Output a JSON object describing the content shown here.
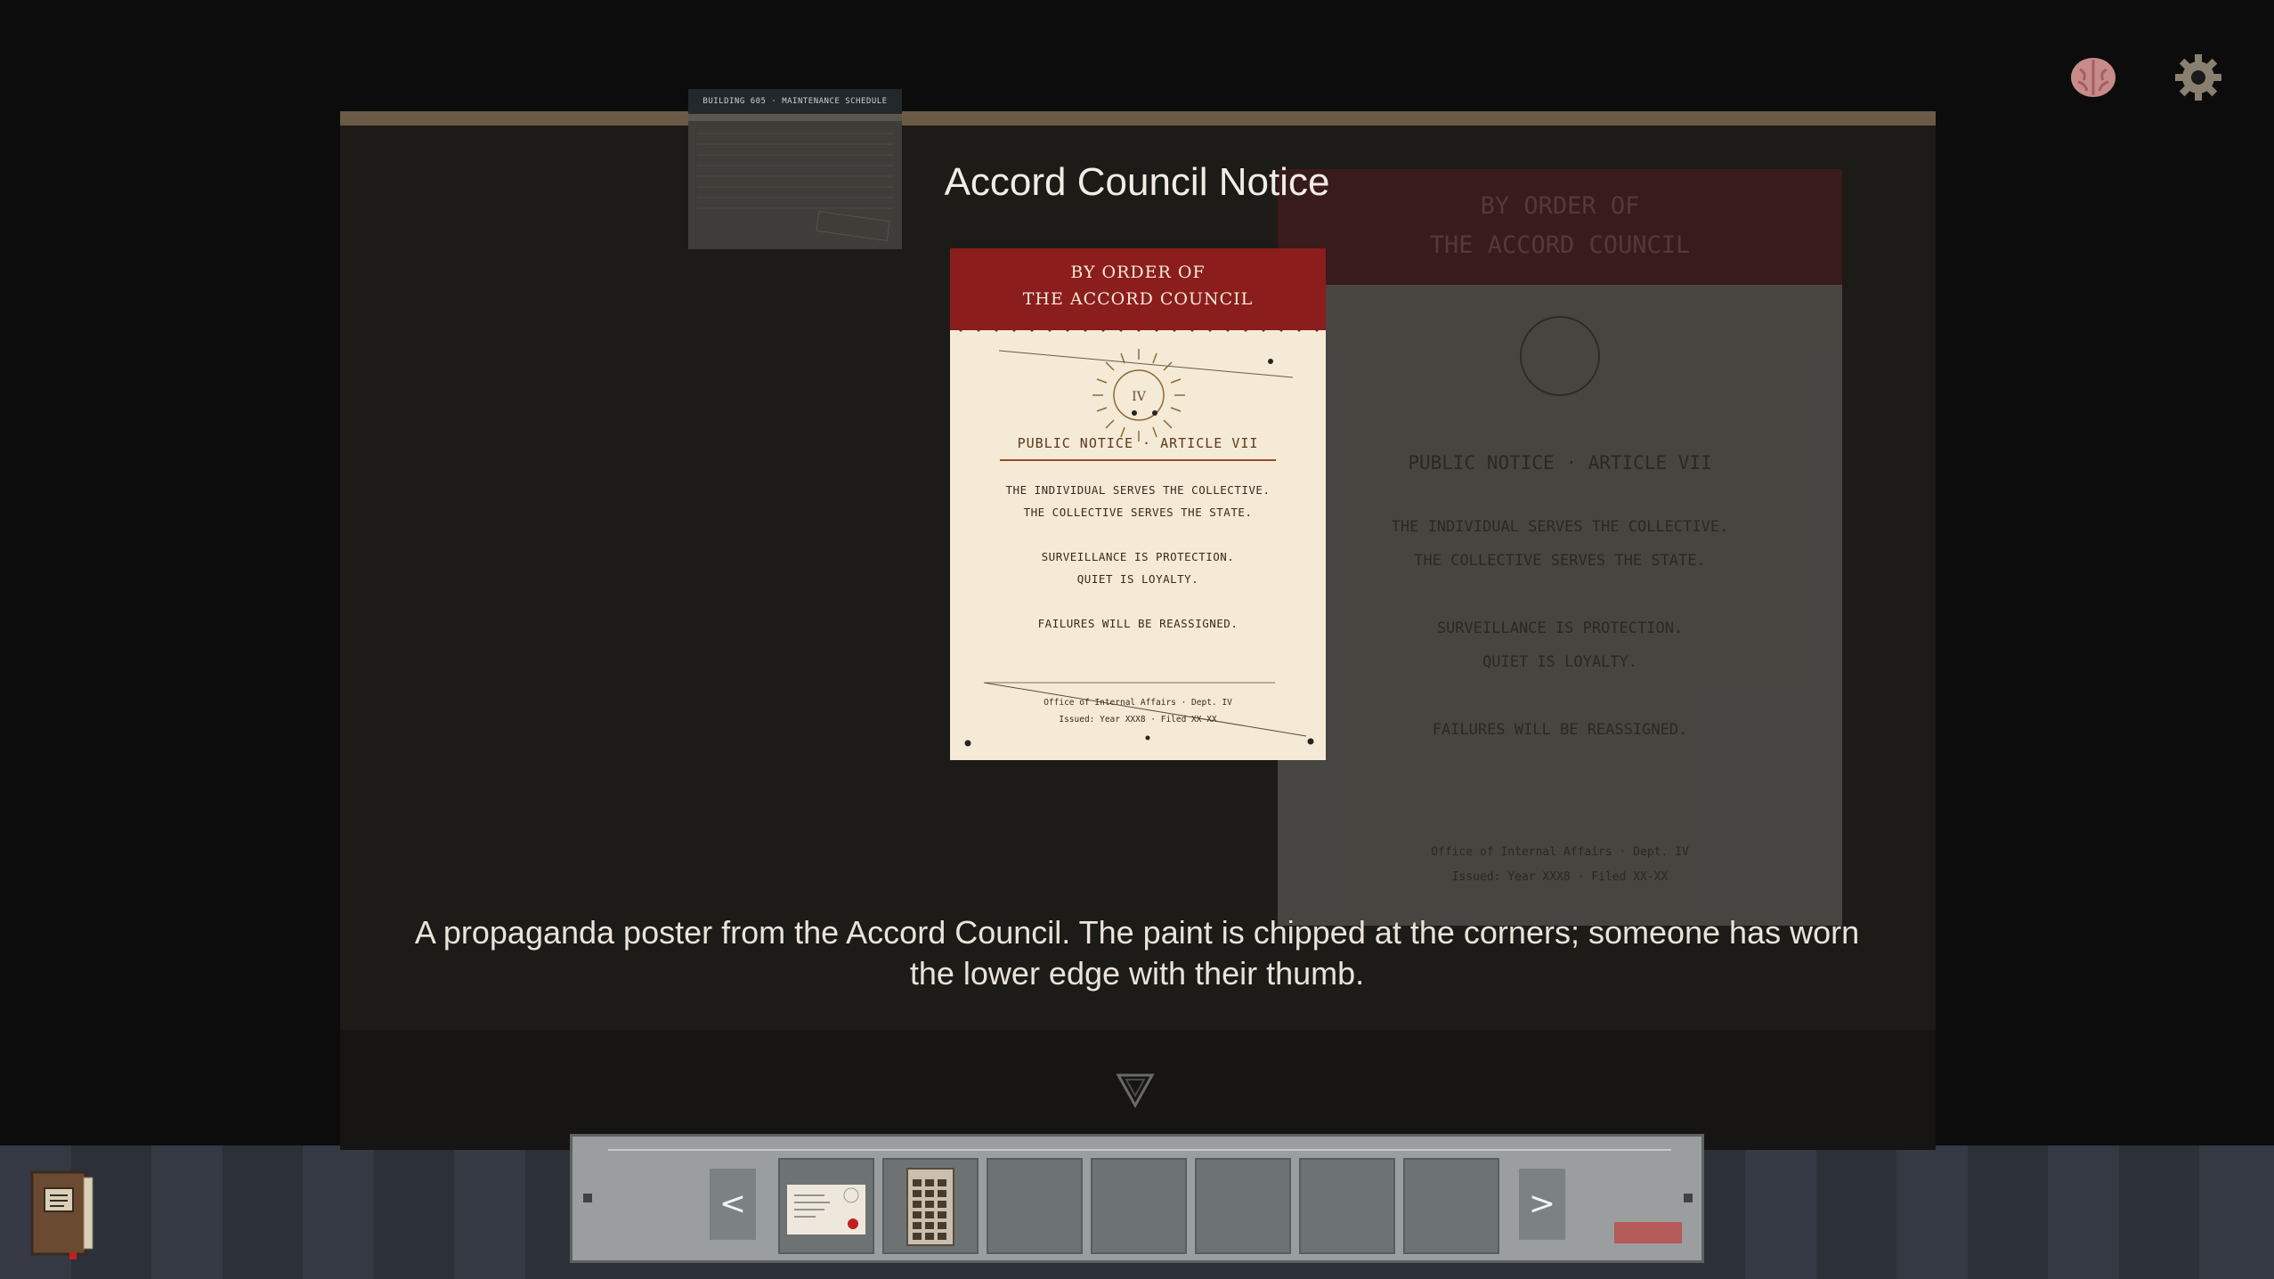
{
  "hud": {
    "brain_icon": "brain-icon",
    "gear_icon": "gear-icon"
  },
  "background_doc": {
    "header": "BUILDING 605 · MAINTENANCE SCHEDULE"
  },
  "inspect": {
    "title": "Accord Council Notice",
    "description": "A propaganda poster from the Accord Council. The paint is chipped at the corners; someone has worn the lower edge with their thumb."
  },
  "poster": {
    "header_line1": "BY ORDER OF",
    "header_line2": "THE ACCORD COUNCIL",
    "seal_numeral": "IV",
    "notice_title": "PUBLIC NOTICE · ARTICLE VII",
    "lines": [
      "THE INDIVIDUAL SERVES THE COLLECTIVE.",
      "THE COLLECTIVE SERVES THE STATE.",
      "SURVEILLANCE IS PROTECTION.",
      "QUIET IS LOYALTY.",
      "FAILURES WILL BE REASSIGNED."
    ],
    "footer_dept": "Office of Internal Affairs · Dept. IV",
    "footer_issued": "Issued: Year XXX8 · Filed XX-XX"
  },
  "inventory": {
    "prev_label": "<",
    "next_label": ">",
    "slots": [
      {
        "item": "envelope-letter"
      },
      {
        "item": "calendar-grid"
      },
      {
        "item": ""
      },
      {
        "item": ""
      },
      {
        "item": ""
      },
      {
        "item": ""
      },
      {
        "item": ""
      }
    ]
  },
  "colors": {
    "poster_red": "#8b1d1d",
    "poster_paper": "#f5ead5",
    "panel_bg": "#1d1b18",
    "inventory_bg": "#9a9e9e"
  }
}
